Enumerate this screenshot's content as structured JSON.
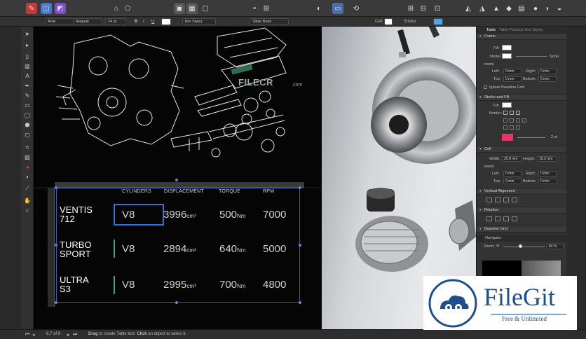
{
  "colors": {
    "accent": "#3b7fd4",
    "watermark_blue": "#1e4f8c",
    "swatch_red": "#e8336b",
    "selection": "#3a5fa8",
    "row_marker": "#3fa27b"
  },
  "context_bar": {
    "font": "Arial",
    "weight": "Regular",
    "size": "24 pt",
    "bold": "B",
    "italic": "I",
    "underline": "U",
    "text_style": "[No Style]",
    "table_style": "Table Body",
    "cell_label": "Cell",
    "stroke_label": "Stroke"
  },
  "watermark_top": {
    "brand": "FILECR",
    "sub": ".com"
  },
  "table": {
    "headers": [
      "CYLINDERS",
      "DISPLACEMENT",
      "TORQUE",
      "RPM"
    ],
    "rows": [
      {
        "name": "VENTIS\n712",
        "cylinders": "V8",
        "displacement": "3996",
        "disp_unit": "cm³",
        "torque": "500",
        "torque_unit": "Nm",
        "rpm": "7000"
      },
      {
        "name": "TURBO\nSPORT",
        "cylinders": "V8",
        "displacement": "2894",
        "disp_unit": "cm³",
        "torque": "640",
        "torque_unit": "Nm",
        "rpm": "5000"
      },
      {
        "name": "ULTRA\nS3",
        "cylinders": "V8",
        "displacement": "2995",
        "disp_unit": "cm³",
        "torque": "700",
        "torque_unit": "Nm",
        "rpm": "4800"
      }
    ]
  },
  "panel": {
    "tabs": [
      "Table",
      "Table Formats",
      "Text Styles"
    ],
    "frame_title": "Frame",
    "fill_label": "Fill:",
    "stroke_label": "Stroke:",
    "stroke_value": "None",
    "insets_label": "Insets",
    "left_label": "Left:",
    "right_label": "Right:",
    "top_label": "Top:",
    "bottom_label": "Bottom:",
    "zero_mm": "0 mm",
    "ignore_baseline": "Ignore Baseline Grid",
    "stroke_fill_title": "Stroke and Fill",
    "border_label": "Border:",
    "stroke_pt": "2 pt",
    "cell_title": "Cell",
    "width_label": "Width:",
    "width_value": "35.8 mm",
    "height_label": "Height:",
    "height_value": "15.3 mm",
    "vertical_alignment_title": "Vertical Alignment",
    "rotation_title": "Rotation",
    "baseline_grid_title": "Baseline Grid",
    "navigator_label": "Navigator",
    "zoom_label": "Zoom:",
    "zoom_value": "84 %"
  },
  "status": {
    "page": "6,7 of 9",
    "hint_drag": "Drag",
    "hint_mid": "to create Table text.",
    "hint_click": "Click",
    "hint_end": "an object to select it."
  },
  "filegit": {
    "name": "FileGit",
    "tagline": "Free & Unlimited"
  }
}
